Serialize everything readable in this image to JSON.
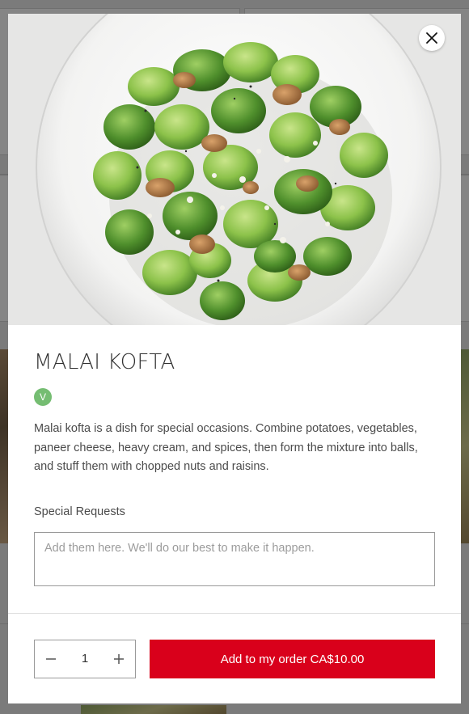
{
  "dish": {
    "title": "MALAI KOFTA",
    "badge": "V",
    "description": "Malai kofta is a dish for special occasions. Combine potatoes, vegetables, paneer cheese, heavy cream, and spices, then form the mixture into balls, and stuff them with chopped nuts and raisins."
  },
  "special_requests": {
    "label": "Special Requests",
    "placeholder": "Add them here. We'll do our best to make it happen.",
    "value": ""
  },
  "order": {
    "quantity": "1",
    "add_label": "Add to my order",
    "price": "CA$10.00"
  },
  "icons": {
    "close": "close-icon",
    "minus": "minus-icon",
    "plus": "plus-icon"
  },
  "colors": {
    "accent": "#d9001b",
    "vegetarian_badge": "#75bd72",
    "overlay": "#7b7b7b"
  }
}
